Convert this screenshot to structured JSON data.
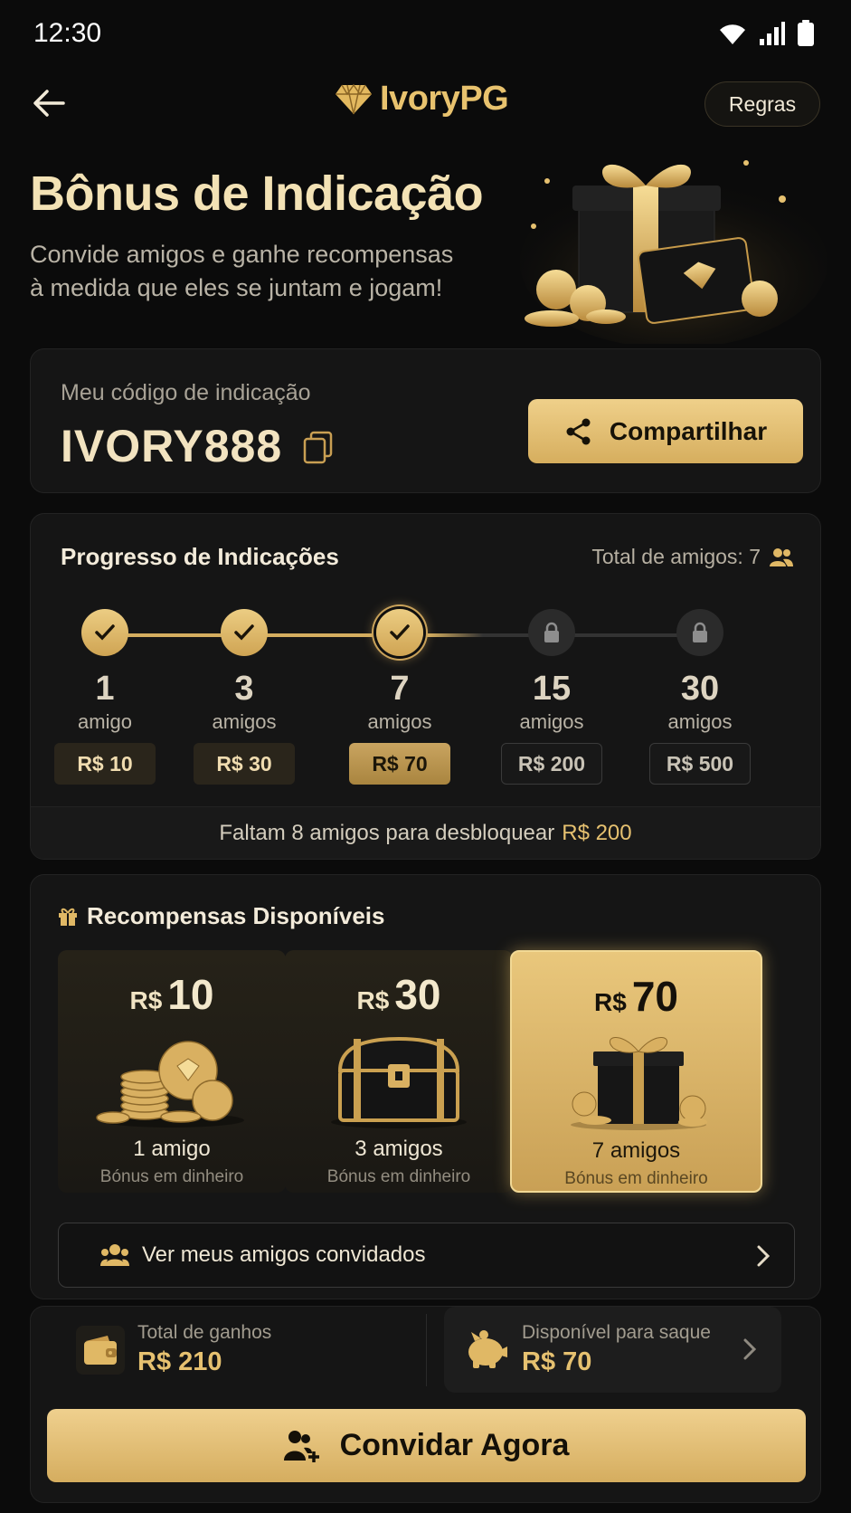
{
  "status_bar": {
    "time": "12:30"
  },
  "header": {
    "brand": "IvoryPG",
    "rules_label": "Regras"
  },
  "hero": {
    "title": "Bônus de Indicação",
    "subtitle_line1": "Convide amigos e ganhe recompensas",
    "subtitle_line2": "à medida que eles se juntam e jogam!"
  },
  "referral_code": {
    "label": "Meu código de indicação",
    "code": "IVORY888",
    "share_label": "Compartilhar"
  },
  "progress": {
    "title": "Progresso de Indicações",
    "total_label": "Total de amigos: 7",
    "milestones": [
      {
        "count": "1",
        "unit": "amigo",
        "reward": "R$ 10",
        "state": "done"
      },
      {
        "count": "3",
        "unit": "amigos",
        "reward": "R$ 30",
        "state": "done"
      },
      {
        "count": "7",
        "unit": "amigos",
        "reward": "R$ 70",
        "state": "current"
      },
      {
        "count": "15",
        "unit": "amigos",
        "reward": "R$ 200",
        "state": "locked"
      },
      {
        "count": "30",
        "unit": "amigos",
        "reward": "R$ 500",
        "state": "locked"
      }
    ],
    "footer_text": "Faltam 8 amigos para desbloquear",
    "footer_highlight": "R$ 200"
  },
  "rewards": {
    "title": "Recompensas Disponíveis",
    "items": [
      {
        "currency": "R$",
        "value": "10",
        "friends": "1 amigo",
        "type": "Bónus em dinheiro",
        "image": "gold-coins-stack"
      },
      {
        "currency": "R$",
        "value": "30",
        "friends": "3 amigos",
        "type": "Bónus em dinheiro",
        "image": "treasure-chest"
      },
      {
        "currency": "R$",
        "value": "70",
        "friends": "7 amigos",
        "type": "Bónus em dinheiro",
        "image": "gift-box"
      }
    ],
    "view_friends_label": "Ver meus amigos convidados"
  },
  "earnings": {
    "total_label": "Total de ganhos",
    "total_value": "R$ 210",
    "withdraw_label": "Disponível para saque",
    "withdraw_value": "R$ 70",
    "invite_label": "Convidar Agora"
  },
  "colors": {
    "accent": "#e6c170",
    "background": "#0b0b0b",
    "card": "#151515"
  }
}
